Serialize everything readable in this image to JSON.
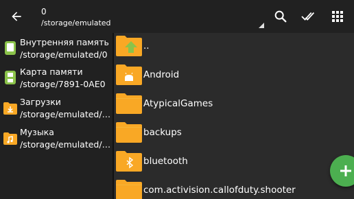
{
  "appbar": {
    "selected_count": "0",
    "current_path": "/storage/emulated",
    "icons": [
      "arrow-back-icon",
      "search-icon",
      "double-check-icon",
      "grid-view-icon"
    ]
  },
  "sidebar": {
    "items": [
      {
        "name": "Внутренняя память",
        "path": "/storage/emulated/0",
        "icon": "phone-storage-icon",
        "color": "#8bc34a"
      },
      {
        "name": "Карта памяти",
        "path": "/storage/7891-0AE0",
        "icon": "sd-card-icon",
        "color": "#8bc34a"
      },
      {
        "name": "Загрузки",
        "path": "/storage/emulated/…",
        "icon": "download-folder-icon",
        "color": "#f9a825"
      },
      {
        "name": "Музыка",
        "path": "/storage/emulated/…",
        "icon": "music-folder-icon",
        "color": "#f9a825"
      }
    ]
  },
  "files": [
    {
      "name": "..",
      "icon": "parent-folder-icon"
    },
    {
      "name": "Android",
      "icon": "android-folder-icon"
    },
    {
      "name": "AtypicalGames",
      "icon": "folder-icon"
    },
    {
      "name": "backups",
      "icon": "folder-icon"
    },
    {
      "name": "bluetooth",
      "icon": "bluetooth-folder-icon"
    },
    {
      "name": "com.activision.callofduty.shooter",
      "icon": "folder-icon"
    }
  ],
  "fab": {
    "icon": "plus-icon"
  },
  "colors": {
    "background": "#212121",
    "list_background": "#2b2b2b",
    "folder": "#f9a825",
    "accent_green": "#4caf50"
  }
}
